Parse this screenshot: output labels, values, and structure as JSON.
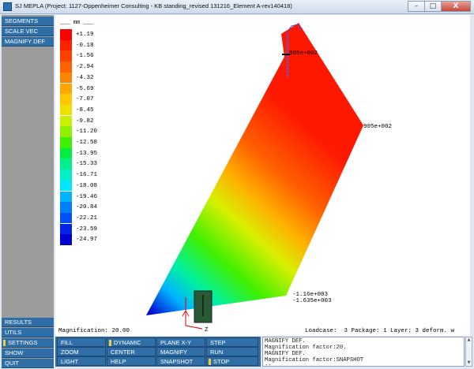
{
  "window": {
    "title": "SJ MEPLA (Project: 1127-Oppenheimer Consulting - KB standing_revised 131216_Element A-rev140418)",
    "minimize": "–",
    "maximize": "□",
    "close": "X"
  },
  "left_menu": {
    "top_items": [
      "SEGMENTS",
      "SCALE VEC",
      "MAGNIFY DEF"
    ],
    "bottom_items": [
      "RESULTS",
      "UTILS",
      "SETTINGS",
      "SHOW",
      "QUIT"
    ]
  },
  "legend": {
    "unit": "___ mm ___",
    "values": [
      "+1.19",
      "-0.18",
      "-1.56",
      "-2.94",
      "-4.32",
      "-5.69",
      "-7.07",
      "-8.45",
      "-9.82",
      "-11.20",
      "-12.58",
      "-13.95",
      "-15.33",
      "-16.71",
      "-18.08",
      "-19.46",
      "-20.84",
      "-22.21",
      "-23.59",
      "-24.97"
    ],
    "colors": [
      "#ff0000",
      "#ff2000",
      "#ff4000",
      "#ff6200",
      "#ff8400",
      "#ffa600",
      "#ffc800",
      "#f0e000",
      "#c8f000",
      "#90f000",
      "#40f000",
      "#00ee40",
      "#00f08c",
      "#00f0c8",
      "#00e8ff",
      "#00b4ff",
      "#0080ff",
      "#0050ff",
      "#0024e8",
      "#0000d0"
    ]
  },
  "viewport": {
    "labels": {
      "top_marker": "905e+002",
      "right_corner": "905e+002",
      "bottom_right_a": "-1.16e+003",
      "bottom_right_b": "-1.635e+003",
      "axis_z": "Z"
    },
    "magnification": "Magnification: 20.00",
    "load_info": "Loadcase:  3 Package: 1 Layer: 3 deform. w"
  },
  "toolbar": {
    "row1": [
      "FILL",
      "DYNAMIC",
      "PLANE X-Y",
      "STEP"
    ],
    "row2": [
      "ZOOM",
      "CENTER",
      "MAGNIFY",
      "RUN"
    ],
    "row3": [
      "LIGHT",
      "HELP",
      "SNAPSHOT",
      "STOP"
    ]
  },
  "console": {
    "lines": [
      "MAGNIFY DEF.",
      "Magnification factor:20.",
      "MAGNIFY DEF.",
      "Magnification factor:SNAPSHOT",
      "::"
    ]
  }
}
